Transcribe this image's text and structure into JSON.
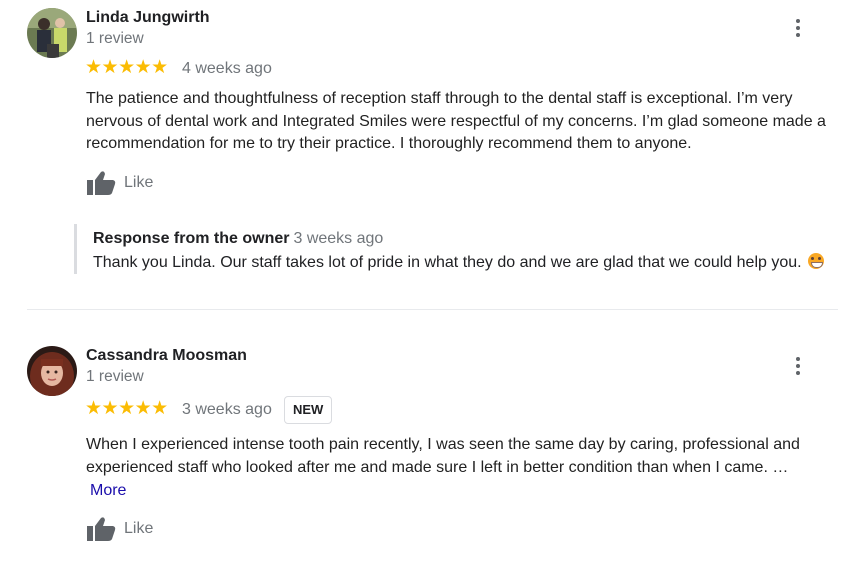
{
  "reviews": [
    {
      "name": "Linda Jungwirth",
      "review_count": "1 review",
      "stars": "★★★★★",
      "rating": 5,
      "date": "4 weeks ago",
      "text": [
        "The patience and thoughtfulness of reception staff through to the dental staff is  exceptional. I’m very",
        "nervous of dental work and Integrated Smiles were respectful of my concerns. I’m glad someone made a",
        "recommendation for me to try their practice. I thoroughly recommend them to anyone."
      ],
      "like_label": "Like",
      "owner_response": {
        "title": "Response from the owner",
        "date": "3 weeks ago",
        "text": "Thank you Linda. Our staff takes lot of pride in what they do and we are glad that we could help you."
      }
    },
    {
      "name": "Cassandra Moosman",
      "review_count": "1 review",
      "stars": "★★★★★",
      "rating": 5,
      "date": "3 weeks ago",
      "badge": "NEW",
      "text": [
        "When I experienced intense tooth pain recently, I was seen the same day by caring, professional and",
        "experienced staff who looked after me and made sure I left in better condition than when I came. …"
      ],
      "more_label": "More",
      "like_label": "Like"
    }
  ],
  "colors": {
    "star": "#fbbc04",
    "link": "#1a0dab",
    "muted": "#70757a",
    "text": "#202124"
  },
  "icons": [
    "more-vert-icon",
    "thumb-up-icon",
    "grinning-face-emoji"
  ]
}
